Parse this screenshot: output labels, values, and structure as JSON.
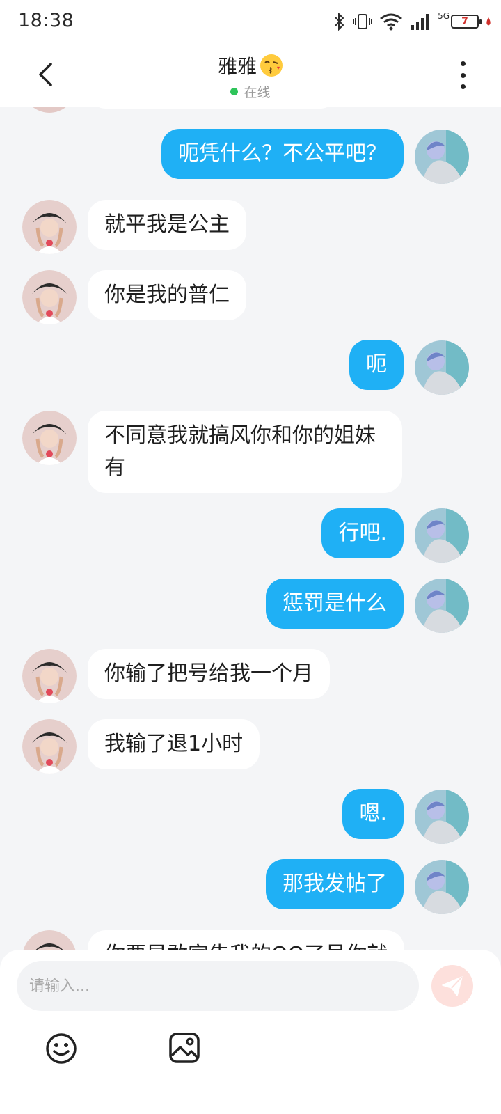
{
  "status_bar": {
    "time": "18:38",
    "network": "5G",
    "battery": "7"
  },
  "header": {
    "contact_name": "雅雅",
    "title_emoji": "kissing-face-emoji",
    "presence": "在线"
  },
  "messages": [
    {
      "side": "right",
      "text": "呃凭什么？不公平吧？"
    },
    {
      "side": "left",
      "text": "就平我是公主"
    },
    {
      "side": "left",
      "text": "你是我的普仁"
    },
    {
      "side": "right",
      "text": "呃"
    },
    {
      "side": "left",
      "text": "不同意我就搞风你和你的姐妹有"
    },
    {
      "side": "right",
      "text": "行吧."
    },
    {
      "side": "right",
      "text": "惩罚是什么"
    },
    {
      "side": "left",
      "text": "你输了把号给我一个月"
    },
    {
      "side": "left",
      "text": "我输了退1小时"
    },
    {
      "side": "right",
      "text": "嗯."
    },
    {
      "side": "right",
      "text": "那我发帖了"
    },
    {
      "side": "left",
      "text": "你要是敢宣告我的QQ了号你就"
    }
  ],
  "composer": {
    "placeholder": "请输入..."
  },
  "icons": {
    "back": "chevron-left-icon",
    "more": "more-vertical-icon",
    "send": "paper-plane-icon",
    "emoji": "smiley-icon",
    "image": "image-icon"
  },
  "colors": {
    "accent": "#1fb0f5",
    "online": "#2ec45a",
    "send_disabled": "#fde0dc"
  }
}
